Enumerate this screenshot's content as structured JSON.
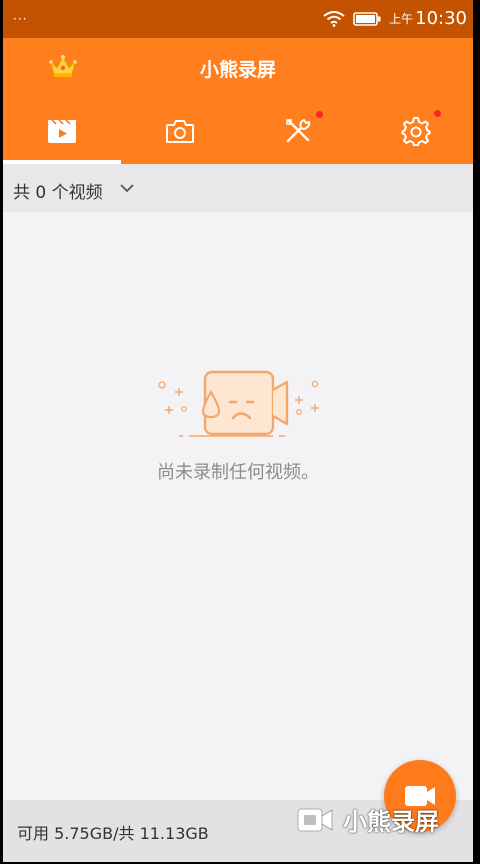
{
  "status_bar": {
    "dots": "···",
    "ampm": "上午",
    "time": "10:30"
  },
  "app": {
    "title": "小熊录屏"
  },
  "tabs": [
    {
      "icon": "video-clapper-icon",
      "active": true
    },
    {
      "icon": "camera-icon",
      "active": false
    },
    {
      "icon": "tools-icon",
      "active": false,
      "badge": true
    },
    {
      "icon": "settings-gear-icon",
      "active": false,
      "badge": true
    }
  ],
  "filter": {
    "label": "共 0 个视频"
  },
  "empty_state": {
    "message": "尚未录制任何视频。"
  },
  "storage": {
    "text": "可用 5.75GB/共 11.13GB"
  },
  "watermark": {
    "text": "小熊录屏"
  },
  "colors": {
    "status_bar": "#c35300",
    "app_bar": "#ff7f1f",
    "badge": "#ff2424",
    "empty_icon": "#f4a76a"
  }
}
